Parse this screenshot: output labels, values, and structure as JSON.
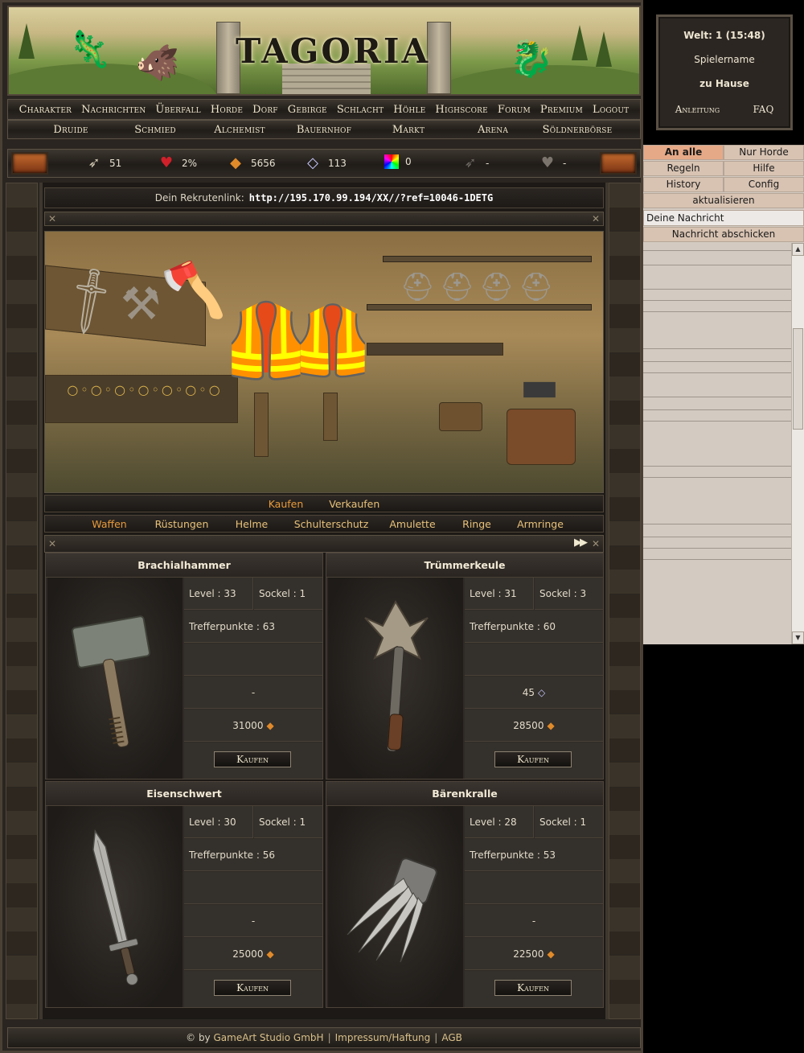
{
  "banner": {
    "logo": "TAGORIA"
  },
  "main_nav": [
    "Charakter",
    "Nachrichten",
    "Überfall",
    "Horde",
    "Dorf",
    "Gebirge",
    "Schlacht",
    "Höhle",
    "Highscore",
    "Forum",
    "Premium",
    "Logout"
  ],
  "sub_nav": [
    "Druide",
    "Schmied",
    "Alchemist",
    "Bauernhof",
    "Markt",
    "Arena",
    "Söldnerbörse"
  ],
  "stats": {
    "attack": "51",
    "health": "2%",
    "gold": "5656",
    "gems": "113",
    "rainbow": "0",
    "arrow2": "-",
    "shield": "-"
  },
  "recruit": {
    "label": "Dein Rekrutenlink:",
    "url": "http://195.170.99.194/XX//?ref=10046-1DETG"
  },
  "shop_tabs": {
    "buy": "Kaufen",
    "sell": "Verkaufen"
  },
  "categories": [
    "Waffen",
    "Rüstungen",
    "Helme",
    "Schulterschutz",
    "Amulette",
    "Ringe",
    "Armringe"
  ],
  "next_label": "▶▶",
  "items": [
    {
      "name": "Brachialhammer",
      "level": "Level : 33",
      "socket": "Sockel : 1",
      "hp": "Trefferpunkte : 63",
      "gem_cost": "-",
      "gem_visible": false,
      "price": "31000",
      "buy": "Kaufen"
    },
    {
      "name": "Trümmerkeule",
      "level": "Level : 31",
      "socket": "Sockel : 3",
      "hp": "Trefferpunkte : 60",
      "gem_cost": "45",
      "gem_visible": true,
      "price": "28500",
      "buy": "Kaufen"
    },
    {
      "name": "Eisenschwert",
      "level": "Level : 30",
      "socket": "Sockel : 1",
      "hp": "Trefferpunkte : 56",
      "gem_cost": "-",
      "gem_visible": false,
      "price": "25000",
      "buy": "Kaufen"
    },
    {
      "name": "Bärenkralle",
      "level": "Level : 28",
      "socket": "Sockel : 1",
      "hp": "Trefferpunkte : 53",
      "gem_cost": "-",
      "gem_visible": false,
      "price": "22500",
      "buy": "Kaufen"
    }
  ],
  "footer": {
    "copyright": "© by",
    "company": "GameArt Studio GmbH",
    "impressum": "Impressum/Haftung",
    "agb": "AGB"
  },
  "world": {
    "title": "Welt: 1 (15:48)",
    "player": "Spielername",
    "location": "zu Hause",
    "guide": "Anleitung",
    "faq": "FAQ"
  },
  "chat": {
    "all": "An alle",
    "horde_only": "Nur Horde",
    "rules": "Regeln",
    "help": "Hilfe",
    "history": "History",
    "config": "Config",
    "refresh": "aktualisieren",
    "input_value": "Deine Nachricht",
    "send": "Nachricht abschicken"
  },
  "colors": {
    "accent_tab": "#e89a3a",
    "chat_active": "#e6a987",
    "chat_button": "#d8c3b2"
  },
  "icons": [
    "arrow-icon",
    "heart-icon",
    "gold-icon",
    "diamond-icon",
    "rainbow-icon",
    "arrow-dark-icon",
    "shield-icon"
  ]
}
